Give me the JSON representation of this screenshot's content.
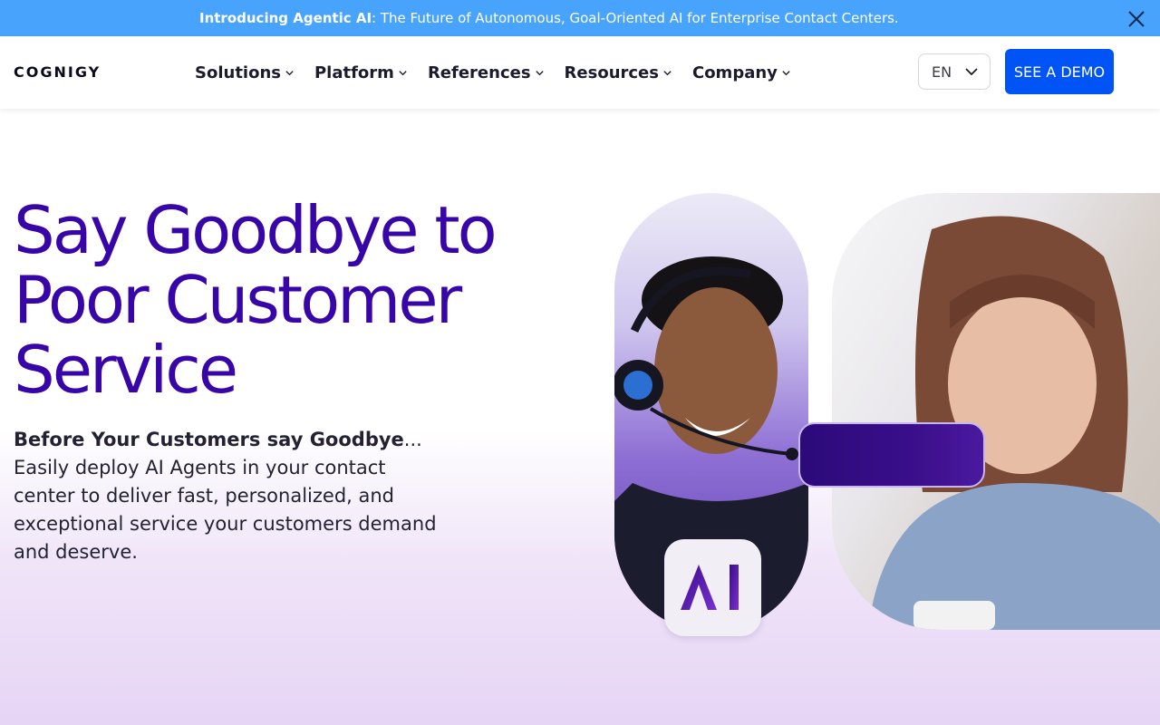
{
  "announcement": {
    "bold_text": "Introducing Agentic AI",
    "text": ": The Future of Autonomous, Goal-Oriented AI for Enterprise Contact Centers.",
    "close_icon": "close-icon",
    "background": "#47a3fb"
  },
  "header": {
    "logo": "COGNIGY",
    "nav": [
      {
        "label": "Solutions"
      },
      {
        "label": "Platform"
      },
      {
        "label": "References"
      },
      {
        "label": "Resources"
      },
      {
        "label": "Company"
      }
    ],
    "language": "EN",
    "cta": "SEE A DEMO",
    "cta_color": "#0053f5"
  },
  "hero": {
    "title": "Say Goodbye to Poor Customer Service",
    "lead_bold": "Before Your Customers say Goodbye",
    "lead_text": "... Easily deploy AI Agents in your contact center to deliver fast, personalized, and exceptional service your customers demand and deserve.",
    "title_color": "#3805a8",
    "badge": "AI"
  }
}
